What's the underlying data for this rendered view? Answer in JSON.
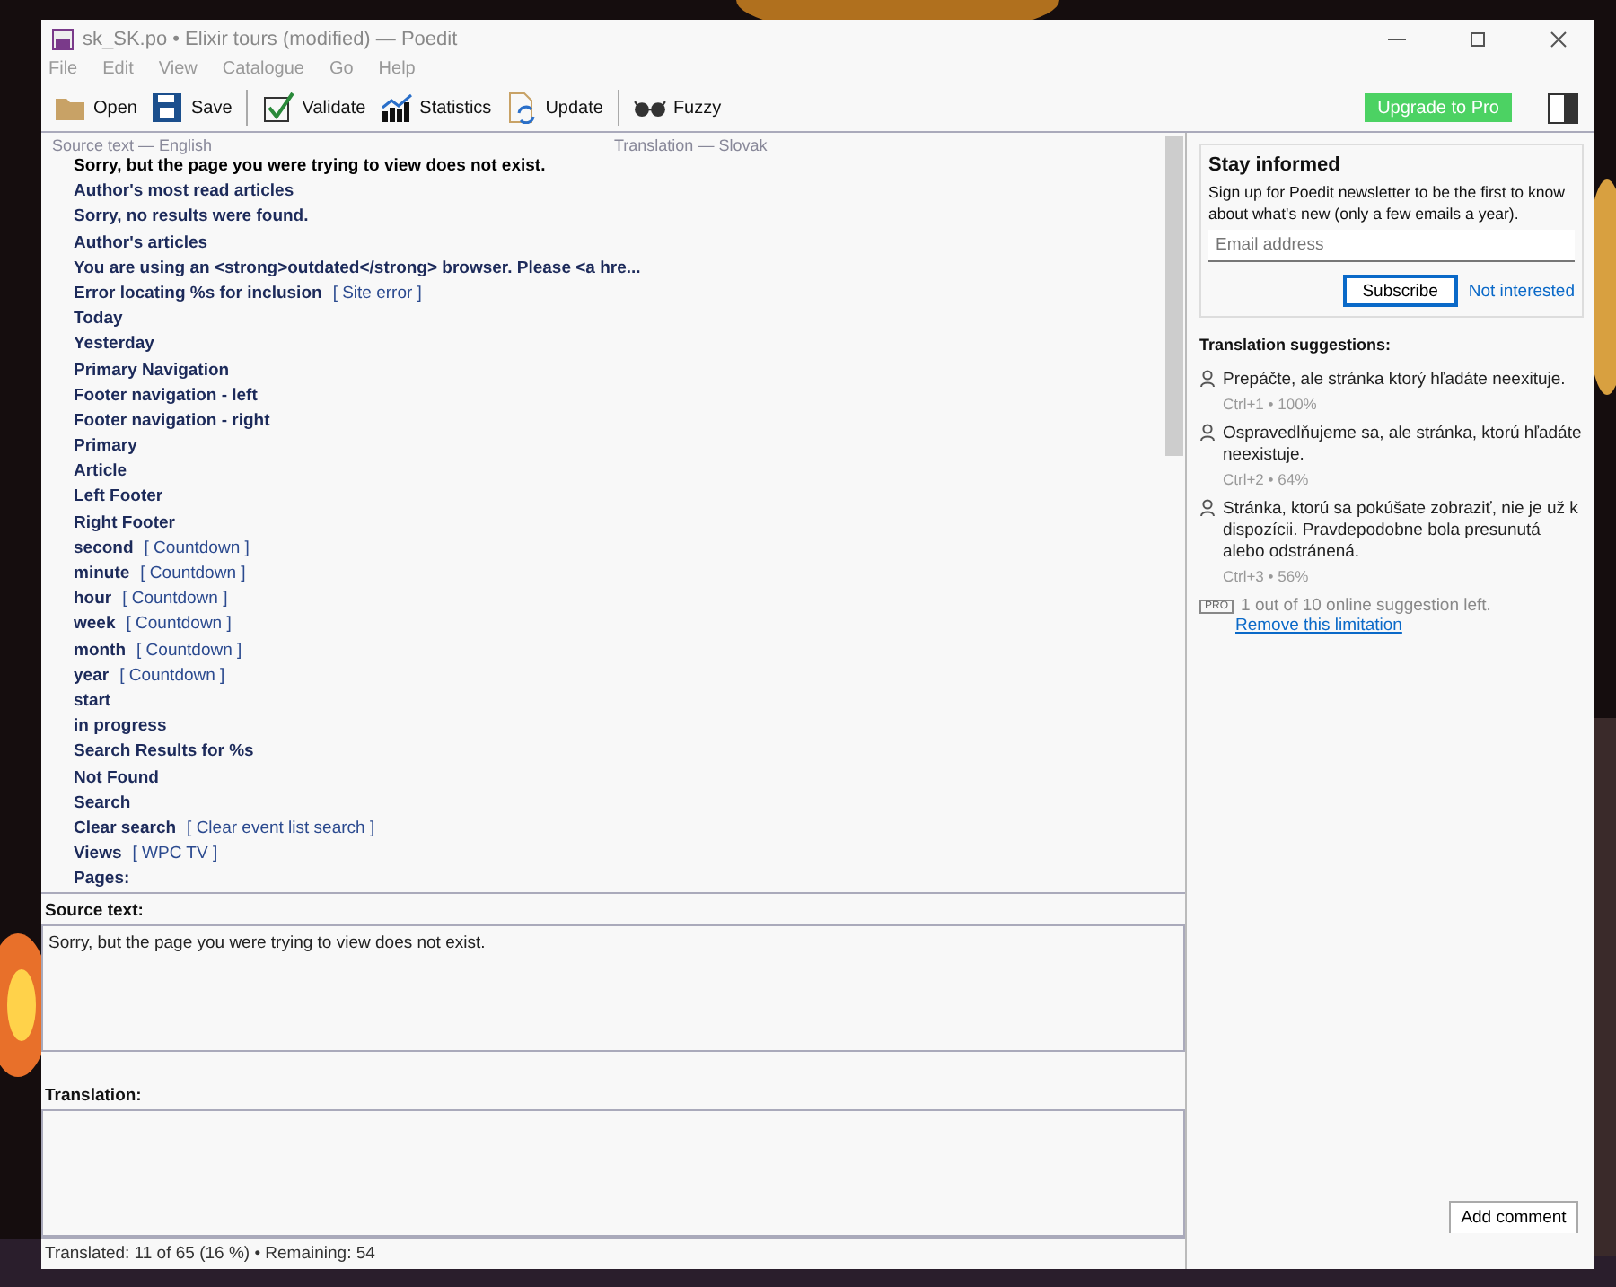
{
  "window": {
    "title": "sk_SK.po • Elixir tours (modified) — Poedit"
  },
  "menu": [
    "File",
    "Edit",
    "View",
    "Catalogue",
    "Go",
    "Help"
  ],
  "toolbar": [
    {
      "kind": "open",
      "label": "Open"
    },
    {
      "kind": "save",
      "label": "Save"
    },
    {
      "kind": "validate",
      "label": "Validate"
    },
    {
      "kind": "statistics",
      "label": "Statistics"
    },
    {
      "kind": "update",
      "label": "Update"
    },
    {
      "kind": "fuzzy",
      "label": "Fuzzy"
    }
  ],
  "upgrade_button": "Upgrade to Pro",
  "list": {
    "columns": [
      "Source text — English",
      "Translation — Slovak"
    ],
    "rows": [
      {
        "text": "Sorry, but the page you were trying to view does not exist.",
        "selected": true
      },
      {
        "text": "Author's most read articles",
        "selected": false
      },
      {
        "text": "Sorry, no results were found.",
        "selected": false
      },
      {
        "text": "Author's articles",
        "selected": false
      },
      {
        "text": "You are using an <strong>outdated</strong> browser. Please <a hre...",
        "selected": false
      },
      {
        "text": "Error locating %s for inclusion",
        "context": "[ Site error ]",
        "selected": false
      },
      {
        "text": "Today",
        "selected": false
      },
      {
        "text": "Yesterday",
        "selected": false
      },
      {
        "text": "Primary Navigation",
        "selected": false
      },
      {
        "text": "Footer navigation - left",
        "selected": false
      },
      {
        "text": "Footer navigation - right",
        "selected": false
      },
      {
        "text": "Primary",
        "selected": false
      },
      {
        "text": "Article",
        "selected": false
      },
      {
        "text": "Left Footer",
        "selected": false
      },
      {
        "text": "Right Footer",
        "selected": false
      },
      {
        "text": "second",
        "context": "[ Countdown ]",
        "selected": false
      },
      {
        "text": "minute",
        "context": "[ Countdown ]",
        "selected": false
      },
      {
        "text": "hour",
        "context": "[ Countdown ]",
        "selected": false
      },
      {
        "text": "week",
        "context": "[ Countdown ]",
        "selected": false
      },
      {
        "text": "month",
        "context": "[ Countdown ]",
        "selected": false
      },
      {
        "text": "year",
        "context": "[ Countdown ]",
        "selected": false
      },
      {
        "text": "start",
        "selected": false
      },
      {
        "text": "in progress",
        "selected": false
      },
      {
        "text": "Search Results for %s",
        "selected": false
      },
      {
        "text": "Not Found",
        "selected": false
      },
      {
        "text": "Search",
        "selected": false
      },
      {
        "text": "Clear search",
        "context": "[ Clear event list search ]",
        "selected": false
      },
      {
        "text": "Views",
        "context": "[ WPC TV ]",
        "selected": false
      },
      {
        "text": "Pages:",
        "selected": false
      }
    ]
  },
  "source": {
    "label": "Source text:",
    "text": "Sorry, but the page you were trying to view does not exist."
  },
  "translation": {
    "label": "Translation:"
  },
  "status_bar": "Translated: 11 of 65 (16 %)  •  Remaining: 54",
  "newsletter": {
    "title": "Stay informed",
    "text": "Sign up for Poedit newsletter to be the first to know about what's new (only a few emails a year).",
    "placeholder": "Email address",
    "subscribe": "Subscribe",
    "dismiss": "Not interested"
  },
  "suggestions": {
    "title": "Translation suggestions:",
    "items": [
      {
        "text": "Prepáčte, ale stránka ktorý hľadáte neexituje.",
        "meta": "Ctrl+1 • 100%"
      },
      {
        "text": "Ospravedlňujeme sa, ale stránka, ktorú hľadáte neexistuje.",
        "meta": "Ctrl+2 • 64%"
      },
      {
        "text": "Stránka, ktorú sa pokúšate zobraziť, nie je už k dispozícii. Pravdepodobne bola presunutá alebo odstránená.",
        "meta": "Ctrl+3 • 56%"
      }
    ],
    "badge": "PRO",
    "limit": "1 out of 10 online suggestion left.",
    "link": "Remove this limitation"
  },
  "add_comment": "Add comment"
}
